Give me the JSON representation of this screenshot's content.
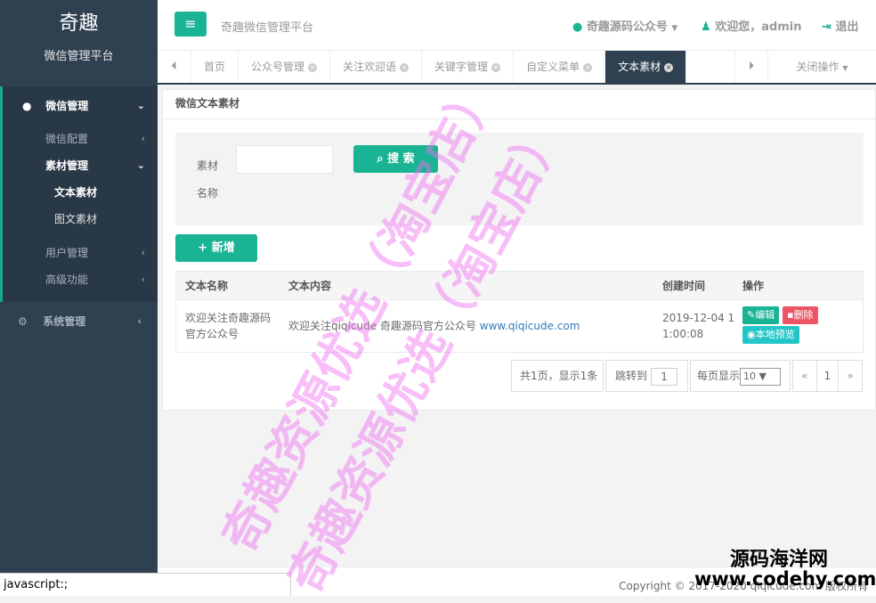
{
  "sidebar": {
    "brand": "奇趣",
    "subtitle": "微信管理平台",
    "wechat_mgmt": "微信管理",
    "wechat_config": "微信配置",
    "material_mgmt": "素材管理",
    "text_material": "文本素材",
    "image_text_material": "图文素材",
    "user_mgmt": "用户管理",
    "advanced": "高级功能",
    "system_mgmt": "系统管理"
  },
  "header": {
    "platform": "奇趣微信管理平台",
    "account": "奇趣源码公众号",
    "welcome": "欢迎您，admin",
    "logout": "退出"
  },
  "tabs": [
    "首页",
    "公众号管理",
    "关注欢迎语",
    "关键字管理",
    "自定义菜单",
    "文本素材"
  ],
  "close_ops": "关闭操作",
  "panel": {
    "title": "微信文本素材",
    "label_material": "素材",
    "label_name": "名称",
    "search_btn": "搜 索",
    "add_btn": "新增"
  },
  "table": {
    "headers": [
      "文本名称",
      "文本内容",
      "创建时间",
      "操作"
    ],
    "rows": [
      {
        "name_line1": "欢迎关注奇趣源码",
        "name_line2": "官方公众号",
        "content_prefix": "欢迎关注qiqicude 奇趣源码官方公众号",
        "content_link": "www.qiqicude.com",
        "time_line1": "2019-12-04 1",
        "time_line2": "1:00:08"
      }
    ],
    "actions": {
      "edit": "编辑",
      "delete": "删除",
      "preview": "本地预览"
    }
  },
  "pager": {
    "summary": "共1页，显示1条",
    "jump_label": "跳转到",
    "jump_value": "1",
    "per_page_label": "每页显示",
    "per_page_value": "10",
    "prev": "«",
    "page": "1",
    "next": "»"
  },
  "footer": {
    "copyright": "Copyright © 2017-2020 qiqicude.com 版权所有"
  },
  "status_bar": "javascript:;",
  "watermark": {
    "stamp": "奇趣资源优选（淘宝店）",
    "site_cn": "源码海洋网",
    "site_url": "www.codehy.com"
  },
  "colors": {
    "sidebar": "#2f4050",
    "accent": "#1ab394",
    "danger": "#ed5565",
    "info": "#23c6c8",
    "stamp": "#f06ef0"
  }
}
